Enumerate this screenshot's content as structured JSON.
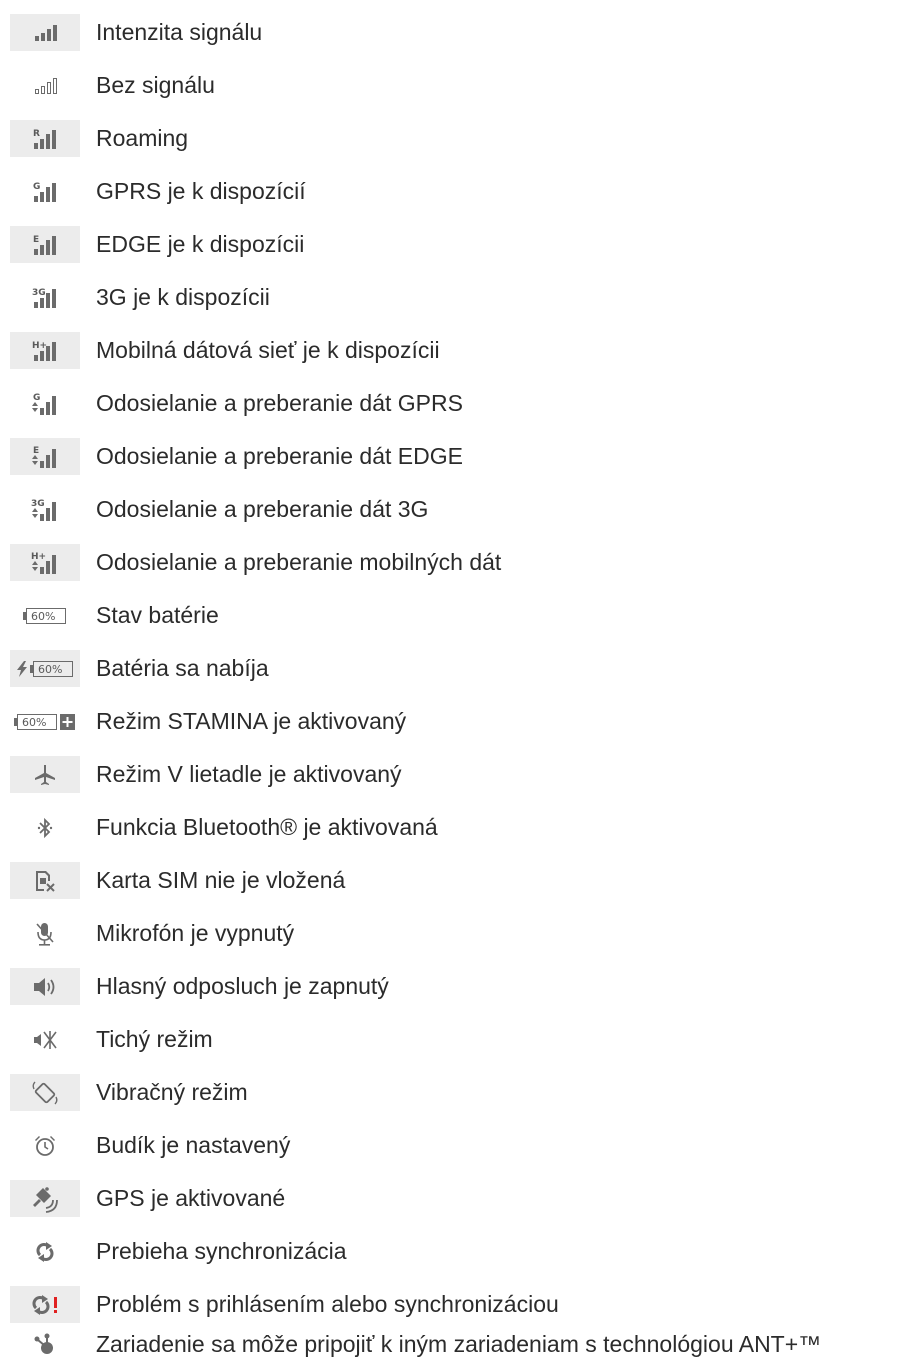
{
  "items": [
    {
      "icon": "signal-strength-icon",
      "label": "Intenzita signálu"
    },
    {
      "icon": "no-signal-icon",
      "label": "Bez signálu"
    },
    {
      "icon": "roaming-icon",
      "label": "Roaming"
    },
    {
      "icon": "gprs-available-icon",
      "label": "GPRS je k dispozícií"
    },
    {
      "icon": "edge-available-icon",
      "label": "EDGE je k dispozícii"
    },
    {
      "icon": "3g-available-icon",
      "label": "3G je k dispozícii"
    },
    {
      "icon": "mobile-data-available-icon",
      "label": "Mobilná dátová sieť je k dispozícii"
    },
    {
      "icon": "gprs-transfer-icon",
      "label": "Odosielanie a preberanie dát GPRS"
    },
    {
      "icon": "edge-transfer-icon",
      "label": "Odosielanie a preberanie dát EDGE"
    },
    {
      "icon": "3g-transfer-icon",
      "label": "Odosielanie a preberanie dát 3G"
    },
    {
      "icon": "mobile-data-transfer-icon",
      "label": "Odosielanie a preberanie mobilných dát"
    },
    {
      "icon": "battery-status-icon",
      "label": "Stav batérie",
      "battery_text": "60%"
    },
    {
      "icon": "battery-charging-icon",
      "label": "Batéria sa nabíja",
      "battery_text": "60%"
    },
    {
      "icon": "stamina-mode-icon",
      "label": "Režim STAMINA je aktivovaný",
      "battery_text": "60%"
    },
    {
      "icon": "airplane-mode-icon",
      "label": "Režim V lietadle je aktivovaný"
    },
    {
      "icon": "bluetooth-icon",
      "label": "Funkcia Bluetooth® je aktivovaná"
    },
    {
      "icon": "no-sim-icon",
      "label": "Karta SIM nie je vložená"
    },
    {
      "icon": "microphone-muted-icon",
      "label": "Mikrofón je vypnutý"
    },
    {
      "icon": "speakerphone-icon",
      "label": "Hlasný odposluch je zapnutý"
    },
    {
      "icon": "silent-mode-icon",
      "label": "Tichý režim"
    },
    {
      "icon": "vibrate-mode-icon",
      "label": "Vibračný režim"
    },
    {
      "icon": "alarm-clock-icon",
      "label": "Budík je nastavený"
    },
    {
      "icon": "gps-icon",
      "label": "GPS je aktivované"
    },
    {
      "icon": "sync-icon",
      "label": "Prebieha synchronizácia"
    },
    {
      "icon": "sync-error-icon",
      "label": "Problém s prihlásením alebo synchronizáciou"
    },
    {
      "icon": "ant-plus-icon",
      "label": "Zariadenie sa môže pripojiť k iným zariadeniam s technológiou ANT+™"
    }
  ],
  "icon_letters": {
    "roaming": "R",
    "gprs": "G",
    "edge": "E",
    "threeg": "3G",
    "hplus": "H+"
  },
  "colors": {
    "icon_gray": "#6b6b6b",
    "icon_bg": "#ececec",
    "text": "#2b2b2b",
    "alert_red": "#e02020"
  }
}
